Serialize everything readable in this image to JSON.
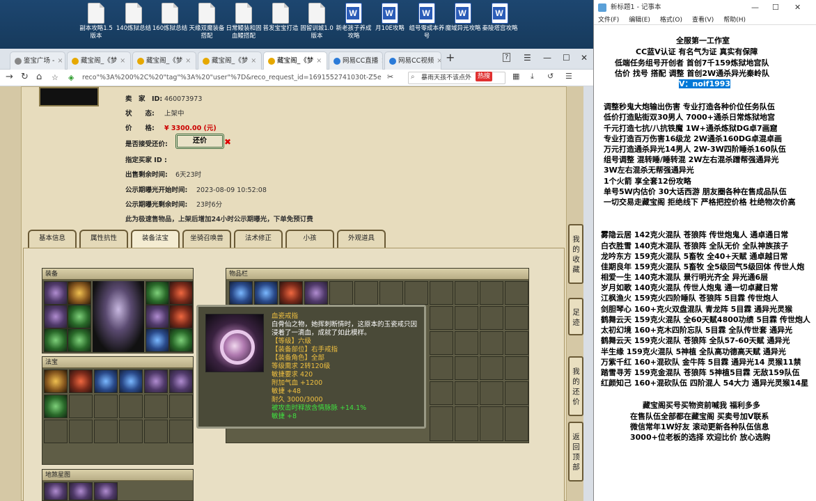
{
  "desktop": {
    "icons": [
      {
        "label": "副本攻略1.5版本",
        "kind": "doc"
      },
      {
        "label": "140炼狱总结",
        "kind": "doc"
      },
      {
        "label": "160炼狱总结",
        "kind": "doc"
      },
      {
        "label": "天缘双魔装备搭配",
        "kind": "doc"
      },
      {
        "label": "日常鳗装和固血鳗搭配",
        "kind": "doc"
      },
      {
        "label": "普发宝宝打造",
        "kind": "doc"
      },
      {
        "label": "固留训城1.0版本",
        "kind": "doc"
      },
      {
        "label": "新老孩子养成攻略",
        "kind": "word"
      },
      {
        "label": "月10E攻略",
        "kind": "word"
      },
      {
        "label": "组号零成本养号",
        "kind": "word"
      },
      {
        "label": "魔域异光攻略",
        "kind": "word"
      },
      {
        "label": "秦陵塔宫攻略",
        "kind": "word"
      }
    ]
  },
  "browser": {
    "tabs": [
      {
        "label": "鉴宝广场 -",
        "color": "#888"
      },
      {
        "label": "藏宝阁_《梦",
        "color": "#e6a800"
      },
      {
        "label": "藏宝阁_《梦",
        "color": "#e6a800"
      },
      {
        "label": "藏宝阁_《梦",
        "color": "#e6a800"
      },
      {
        "label": "藏宝阁_《梦",
        "color": "#e6a800",
        "active": true
      },
      {
        "label": "网易CC直播",
        "color": "#2a7ad8"
      },
      {
        "label": "网易CC视频",
        "color": "#2a7ad8"
      }
    ],
    "url": "reco\"%3A%200%2C%20\"tag\"%3A%20\"user\"%7D&reco_request_id=1691552741030t-Z5e",
    "search_text": "暴雨天孩不该点外",
    "hot_badge": "热搜"
  },
  "item": {
    "seller_label": "卖　家　ID:",
    "seller_id": "460073973",
    "status_label": "状　　态:",
    "status": "上架中",
    "price_label": "价　　格:",
    "price": "¥ 3300.00 (元)",
    "counter_label": "是否接受还价:",
    "counter_button": "还价",
    "buyer_label": "指定买家 ID :",
    "remain_label": "出售剩余时间:",
    "remain": "6天23时",
    "pub_start_label": "公示期曝光开始时间:",
    "pub_start": "2023-08-09 10:52:08",
    "pub_remain_label": "公示期曝光剩余时间:",
    "pub_remain": "23时6分",
    "notice": "此为极速售物品，上架后增加24小时公示期曝光，下单免预订费"
  },
  "page_tabs": [
    "基本信息",
    "属性抗性",
    "装备法宝",
    "坐骑召唤兽",
    "法术修正",
    "小孩",
    "外观道具"
  ],
  "sections": {
    "equip": "装备",
    "fabao": "法宝",
    "inventory": "物品栏",
    "bottom": "地煞星图"
  },
  "tooltip": {
    "name": "血瓷戒指",
    "desc1": "白骨仙之物，她挥刺断情时，这原本的玉瓷戒只因",
    "desc2": "浸着了一滴血，成就了如此模样。",
    "level": "【等级】六级",
    "slot": "【装备部位】右手戒指",
    "role": "【装备角色】全部",
    "req": "等级需求 2转120级",
    "agi": "敏捷要求 420",
    "qixue": "附加气血 +1200",
    "minjie": "敏捷 +48",
    "naijiu": "耐久 3000/3000",
    "special": "被攻击时释放含情脉脉 +14.1%",
    "minjie2": "敏捷 +8"
  },
  "side_buttons": [
    "我的收藏",
    "足迹",
    "我的还价",
    "返回顶部"
  ],
  "notepad": {
    "title": "新标题1 - 记事本",
    "menu": [
      "文件(F)",
      "编辑(E)",
      "格式(O)",
      "查看(V)",
      "帮助(H)"
    ],
    "lines": [
      "全服第一工作室",
      "CC蓝V认证  有名气为证  真实有保障",
      "低端任务组号开创者        首创7千159炼狱地宫队",
      "估价 找号 搭配 调整        首创2W通杀异光秦岭队",
      "V：noif1993",
      "调整秒鬼大炮输出伤害        专业打造各种价位任务队伍",
      "低价打造贴街双30男人          7000+通杀日常炼狱地宫",
      "千元打造七抗/八抗铁魔           1W+通杀炼狱DG卓7画窟",
      "专业打造百万伤害16级龙         2W通杀160DG卓混卓画",
      "万元打造通杀异光14男人        2W-3W四阶睡杀160队伍",
      "组号调整 混转睡/睡转混          2W左右混杀蹭帮强通异光",
      "                                    3W左右混杀无帮强通异光",
      "1个火箭 享全套12份攻略",
      "单号5W内估价 30大话西游        朋友圈各种在售成品队伍",
      "一切交易走藏宝阁 拒绝线下    严格把控价格 杜绝物次价高",
      "雾隐云居 142克火混队 苍狼阵 传世炮鬼人 通卓通日常",
      "白衣胜雪 140克木混队 苍狼阵 全队无价 全队神族孩子",
      "龙吟东方 159克火混队 5畜牧 全40+天赋 通卓越日常",
      "佳期良年 159克火混队 5畜牧 全5级回气5级回体 传世人炮",
      "相爱一生 140克木混队 景行明光齐全 异光通6层",
      "岁月如歌 140克火混队 传世人炮鬼 通一切卓藏日常",
      "江枫渔火 159克火四阶睡队 苍狼阵 5目霖 传世炮人",
      "剑胆琴心 160+克火双盘混队 青龙阵 5目霖 通异光灵猴",
      "鹤舞云天 159克火混队 全60天赋4800功绩 5目霖 传世炮人",
      "太初幻境 160+克木四阶忘队 5目霖 全队传世套 通异光",
      "鹤舞云天 159克火混队 苍狼阵 全队57-60天赋 通异光",
      "半生缘    159克火混队 5神植 全队高功德高天赋 通异光",
      "万紫千红 160+混砍队 金牛阵 5目霖 通异光14 灵猴11禁",
      "踏雪寻芳 159克金混队 苍狼阵 5神植5目霖 无敌159队伍",
      "红颜知己 160+混砍队伍 四阶混人 54大力 通异光灵猴14星",
      "藏宝阁买号买物资前喊我 福利多多",
      "在售队伍全部都在藏宝阁 买卖号加V联系",
      "微信常年1W好友 滚动更新各种队伍信息",
      "3000+位老板的选择 欢迎比价 放心选购"
    ]
  }
}
